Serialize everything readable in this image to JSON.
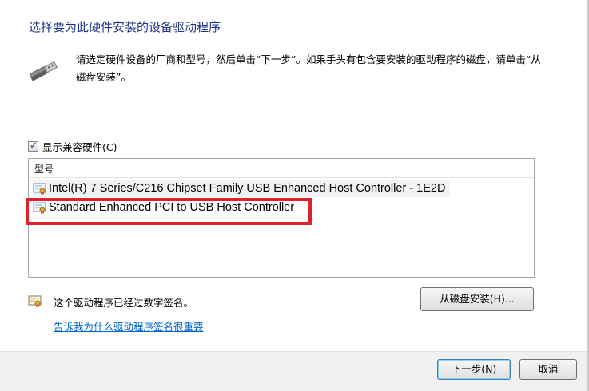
{
  "title": "选择要为此硬件安装的设备驱动程序",
  "description": "请选定硬件设备的厂商和型号，然后单击“下一步”。如果手头有包含要安装的驱动程序的磁盘，请单击“从磁盘安装”。",
  "compatible_checkbox": {
    "label": "显示兼容硬件(C)",
    "checked": true
  },
  "list": {
    "header": "型号",
    "items": [
      "Intel(R) 7 Series/C216 Chipset Family USB Enhanced Host Controller - 1E2D",
      "Standard Enhanced PCI to USB Host Controller"
    ]
  },
  "signature": {
    "text": "这个驱动程序已经过数字签名。",
    "link": "告诉我为什么驱动程序签名很重要"
  },
  "buttons": {
    "have_disk": "从磁盘安装(H)...",
    "next": "下一步(N)",
    "cancel": "取消"
  },
  "colors": {
    "title": "#1e3287",
    "link": "#0066cc",
    "highlight": "#e0202a"
  }
}
